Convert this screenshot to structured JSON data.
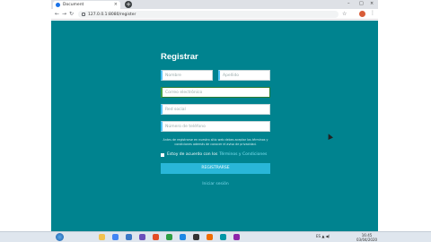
{
  "browser": {
    "tab_title": "Document",
    "tab_close": "×",
    "new_tab": "+",
    "url": "127.0.0.1:8080/register",
    "window_controls": {
      "minimize": "–",
      "maximize": "□",
      "close": "×"
    },
    "nav": {
      "back": "←",
      "forward": "→",
      "reload": "↻"
    },
    "star": "☆",
    "menu": "⋮"
  },
  "form": {
    "title": "Registrar",
    "nombre_placeholder": "Nombre",
    "apellido_placeholder": "Apellido",
    "email_placeholder": "Correo electrónico",
    "social_placeholder": "Red social",
    "phone_placeholder": "Número de teléfono",
    "terms_text": "Antes de registrarse en nuestro sitio web debes aceptar los términos y condiciones además de conocer el aviso de privacidad.",
    "checkbox_label": "Estoy de acuerdo con los",
    "checkbox_link": "Términos y Condiciones",
    "submit_label": "REGISTRARSE",
    "login_link": "Iniciar sesión"
  },
  "taskbar": {
    "tray_text": "ES ▲ ◀)",
    "time": "16:45",
    "date": "03/04/2020"
  },
  "colors": {
    "page_bg": "#00838f",
    "button": "#29b6d8",
    "accent_link": "#80e1f0"
  }
}
